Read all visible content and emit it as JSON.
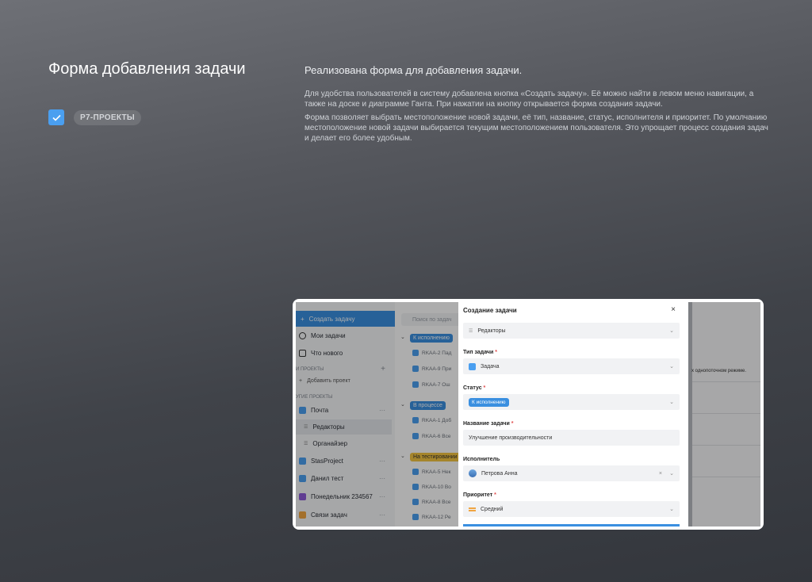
{
  "left": {
    "title": "Форма добавления задачи",
    "tag": "P7-ПРОЕКТЫ"
  },
  "right": {
    "headline": "Реализована форма для добавления задачи.",
    "paragraph1": "Для удобства пользователей в систему добавлена кнопка «Создать задачу». Её можно найти в левом меню навигации, а также на доске и диаграмме Ганта. При нажатии на кнопку открывается форма создания задачи.",
    "paragraph2": "Форма позволяет выбрать местоположение новой задачи, её тип, название, статус, исполнителя и приоритет. По умолчанию местоположение новой задачи выбирается текущим местоположением пользователя. Это упрощает процесс создания задач и делает его более удобным."
  },
  "screenshot": {
    "sidebar": {
      "create": "Создать задачу",
      "my_tasks": "Мои задачи",
      "whats_new": "Что нового",
      "my_projects": "И ПРОЕКТЫ",
      "add_project": "Добавить проект",
      "other_projects": "УГИЕ ПРОЕКТЫ",
      "projects": [
        {
          "label": "Почта",
          "color": "#4a9ff0"
        },
        {
          "label": "Редакторы",
          "sub": true
        },
        {
          "label": "Органайзер",
          "sub": true
        },
        {
          "label": "StasProject",
          "color": "#4a9ff0"
        },
        {
          "label": "Данил тест",
          "color": "#4a9ff0"
        },
        {
          "label": "Понедельник 234567",
          "color": "#8e5bd8"
        },
        {
          "label": "Связи задач",
          "color": "#f0a542"
        }
      ]
    },
    "board": {
      "search_placeholder": "Поиск по задач",
      "groups": [
        {
          "label": "К исполнению",
          "tasks": [
            "RKAA-2 Пад",
            "RKAA-9 При",
            "RKAA-7 Ош"
          ]
        },
        {
          "label": "В процессе",
          "tasks": [
            "RKAA-1 Доб",
            "RKAA-6 Все"
          ]
        },
        {
          "label": "На тестировании",
          "tasks": [
            "RKAA-5 Нек",
            "RKAA-10 Во",
            "RKAA-8 Все",
            "RKAA-12 Ре"
          ]
        }
      ]
    },
    "modal": {
      "title": "Создание задачи",
      "close": "×",
      "location": "Редакторы",
      "type_label": "Тип задачи",
      "type_value": "Задача",
      "status_label": "Статус",
      "status_value": "К исполнению",
      "name_label": "Название задачи",
      "name_value": "Улучшение производительности",
      "assignee_label": "Исполнитель",
      "assignee_value": "Петрова Анна",
      "priority_label": "Приоритет",
      "priority_value": "Средний",
      "required_mark": "*"
    },
    "right_panel": {
      "text": "х однопоточном режиме."
    }
  }
}
